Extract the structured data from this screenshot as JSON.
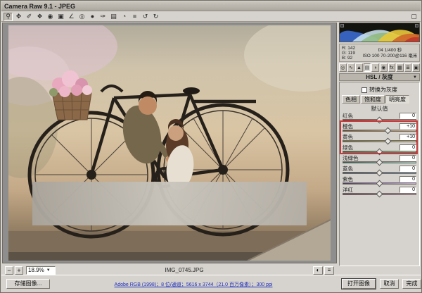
{
  "window": {
    "title": "Camera Raw 9.1 - JPEG"
  },
  "toolbar": {
    "tools": [
      {
        "name": "zoom-tool",
        "glyph": "⚲",
        "selected": true
      },
      {
        "name": "hand-tool",
        "glyph": "✥",
        "selected": false
      },
      {
        "name": "white-balance-tool",
        "glyph": "✐",
        "selected": false
      },
      {
        "name": "color-sampler-tool",
        "glyph": "❖",
        "selected": false
      },
      {
        "name": "targeted-adjustment-tool",
        "glyph": "◉",
        "selected": false
      },
      {
        "name": "crop-tool",
        "glyph": "▣",
        "selected": false
      },
      {
        "name": "straighten-tool",
        "glyph": "∠",
        "selected": false
      },
      {
        "name": "spot-removal-tool",
        "glyph": "◎",
        "selected": false
      },
      {
        "name": "red-eye-tool",
        "glyph": "●",
        "selected": false
      },
      {
        "name": "adjustment-brush-tool",
        "glyph": "✑",
        "selected": false
      },
      {
        "name": "graduated-filter-tool",
        "glyph": "▤",
        "selected": false
      },
      {
        "name": "radial-filter-tool",
        "glyph": "◔",
        "selected": false
      },
      {
        "name": "preferences-button",
        "glyph": "≡",
        "selected": false
      },
      {
        "name": "rotate-left-button",
        "glyph": "↺",
        "selected": false
      },
      {
        "name": "rotate-right-button",
        "glyph": "↻",
        "selected": false
      }
    ],
    "fullscreen_glyph": "▢"
  },
  "histogram": {
    "rgb": [
      {
        "label": "R:",
        "value": "142"
      },
      {
        "label": "G:",
        "value": "119"
      },
      {
        "label": "B:",
        "value": "92"
      }
    ],
    "exif_line1": "f/4  1/400 秒",
    "exif_line2": "ISO 100  70-200@116 毫米"
  },
  "panel": {
    "tabs": [
      {
        "name": "tab-basic",
        "glyph": "◎",
        "selected": false
      },
      {
        "name": "tab-tone-curve",
        "glyph": "∿",
        "selected": false
      },
      {
        "name": "tab-detail",
        "glyph": "▲",
        "selected": false
      },
      {
        "name": "tab-hsl-grayscale",
        "glyph": "▤",
        "selected": true
      },
      {
        "name": "tab-split-toning",
        "glyph": "◑",
        "selected": false
      },
      {
        "name": "tab-lens-corrections",
        "glyph": "◉",
        "selected": false
      },
      {
        "name": "tab-effects",
        "glyph": "fx",
        "selected": false
      },
      {
        "name": "tab-camera-calibration",
        "glyph": "▦",
        "selected": false
      },
      {
        "name": "tab-presets",
        "glyph": "≣",
        "selected": false
      },
      {
        "name": "tab-snapshots",
        "glyph": "▣",
        "selected": false
      }
    ],
    "title": "HSL / 灰度",
    "menu_arrow": "▼",
    "grayscale_checkbox_label": "转换为灰度",
    "subtabs": [
      {
        "label": "色相",
        "selected": false
      },
      {
        "label": "饱和度",
        "selected": false
      },
      {
        "label": "明亮度",
        "selected": true
      }
    ],
    "default_link": "默认值",
    "sliders": [
      {
        "label": "红色",
        "value": "0",
        "num": 0,
        "track": [
          "#6e3030",
          "#e0a0a0"
        ]
      },
      {
        "label": "橙色",
        "value": "+10",
        "num": 10,
        "track": [
          "#6e4a28",
          "#e0c098"
        ]
      },
      {
        "label": "黄色",
        "value": "+10",
        "num": 10,
        "track": [
          "#6e6428",
          "#e0d898"
        ]
      },
      {
        "label": "绿色",
        "value": "0",
        "num": 0,
        "track": [
          "#3c5c30",
          "#a8d0a0"
        ]
      },
      {
        "label": "浅绿色",
        "value": "0",
        "num": 0,
        "track": [
          "#2f5c52",
          "#a0d0c8"
        ]
      },
      {
        "label": "蓝色",
        "value": "0",
        "num": 0,
        "track": [
          "#2f4460",
          "#98b4d8"
        ]
      },
      {
        "label": "紫色",
        "value": "0",
        "num": 0,
        "track": [
          "#4a3c60",
          "#c0aed8"
        ]
      },
      {
        "label": "洋红",
        "value": "0",
        "num": 0,
        "track": [
          "#5c3050",
          "#d8a8c8"
        ]
      }
    ],
    "annotation_color": "#c43b3b"
  },
  "statusbar": {
    "zoom_out": "−",
    "zoom_in": "+",
    "zoom_value": "18.9%",
    "filename": "IMG_0745.JPG",
    "preview_buttons": [
      {
        "name": "before-after-view-button",
        "glyph": "◐"
      },
      {
        "name": "preview-menu-button",
        "glyph": "≡"
      }
    ]
  },
  "footer": {
    "save_button": "存储图像...",
    "workflow_link": "Adobe RGB (1998)；8 位/通道；5616 x 3744（21.0 百万像素）；300 ppi",
    "open_button": "打开图像",
    "cancel_button": "取消",
    "done_button": "完成"
  }
}
